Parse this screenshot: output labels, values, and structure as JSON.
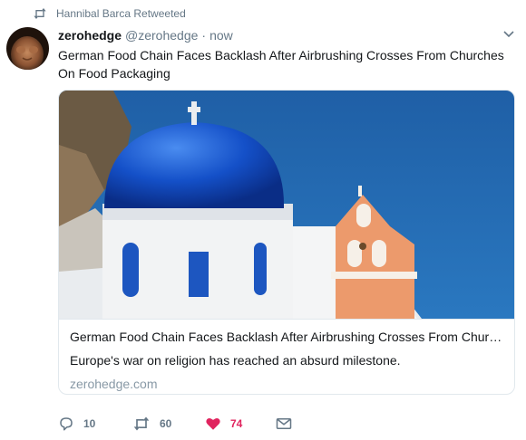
{
  "retweet_context": {
    "icon": "retweet-icon",
    "text": "Hannibal Barca Retweeted"
  },
  "tweet": {
    "avatar": "avatar",
    "display_name": "zerohedge",
    "handle": "@zerohedge",
    "separator": "·",
    "time": "now",
    "caret_icon": "chevron-down-icon",
    "text": "German Food Chain Faces Backlash After Airbrushing Crosses From Churches On Food Packaging"
  },
  "card": {
    "image": "church-dome-photo",
    "title": "German Food Chain Faces Backlash After Airbrushing Crosses From Churc…",
    "description": "Europe's war on religion has reached an absurd milestone.",
    "domain": "zerohedge.com"
  },
  "actions": {
    "reply": {
      "icon": "reply-icon",
      "count": "10"
    },
    "retweet": {
      "icon": "retweet-icon",
      "count": "60"
    },
    "like": {
      "icon": "heart-icon",
      "count": "74",
      "liked": true,
      "color": "#e0245e"
    },
    "dm": {
      "icon": "envelope-icon"
    }
  },
  "colors": {
    "secondary_text": "#657786",
    "border": "#e1e8ed",
    "like": "#e0245e"
  }
}
